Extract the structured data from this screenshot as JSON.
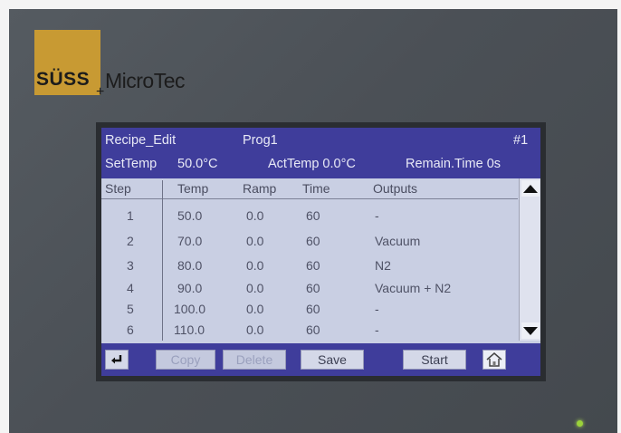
{
  "brand": {
    "name_bold": "SÜSS",
    "plus": "+",
    "name_regular": "MicroTec"
  },
  "header": {
    "screen_title": "Recipe_Edit",
    "program": "Prog1",
    "number": "#1",
    "set_temp_label": "SetTemp",
    "set_temp_value": "50.0°C",
    "act_temp": "ActTemp 0.0°C",
    "remain_time": "Remain.Time 0s"
  },
  "table": {
    "columns": [
      "Step",
      "Temp",
      "Ramp",
      "Time",
      "Outputs"
    ],
    "rows": [
      {
        "step": "1",
        "temp": "50.0",
        "ramp": "0.0",
        "time": "60",
        "outputs": "-"
      },
      {
        "step": "2",
        "temp": "70.0",
        "ramp": "0.0",
        "time": "60",
        "outputs": "Vacuum"
      },
      {
        "step": "3",
        "temp": "80.0",
        "ramp": "0.0",
        "time": "60",
        "outputs": "N2"
      },
      {
        "step": "4",
        "temp": "90.0",
        "ramp": "0.0",
        "time": "60",
        "outputs": "Vacuum + N2"
      },
      {
        "step": "5",
        "temp": "100.0",
        "ramp": "0.0",
        "time": "60",
        "outputs": "-"
      },
      {
        "step": "6",
        "temp": "110.0",
        "ramp": "0.0",
        "time": "60",
        "outputs": "-"
      }
    ]
  },
  "toolbar": {
    "copy_label": "Copy",
    "delete_label": "Delete",
    "save_label": "Save",
    "start_label": "Start",
    "enter_icon": "enter-icon",
    "home_icon": "home-icon"
  },
  "colors": {
    "header_bg": "#3f3d9b",
    "screen_bg": "#c9cfe3",
    "logo_gold": "#c89a33",
    "led_green": "#9bd23a"
  }
}
